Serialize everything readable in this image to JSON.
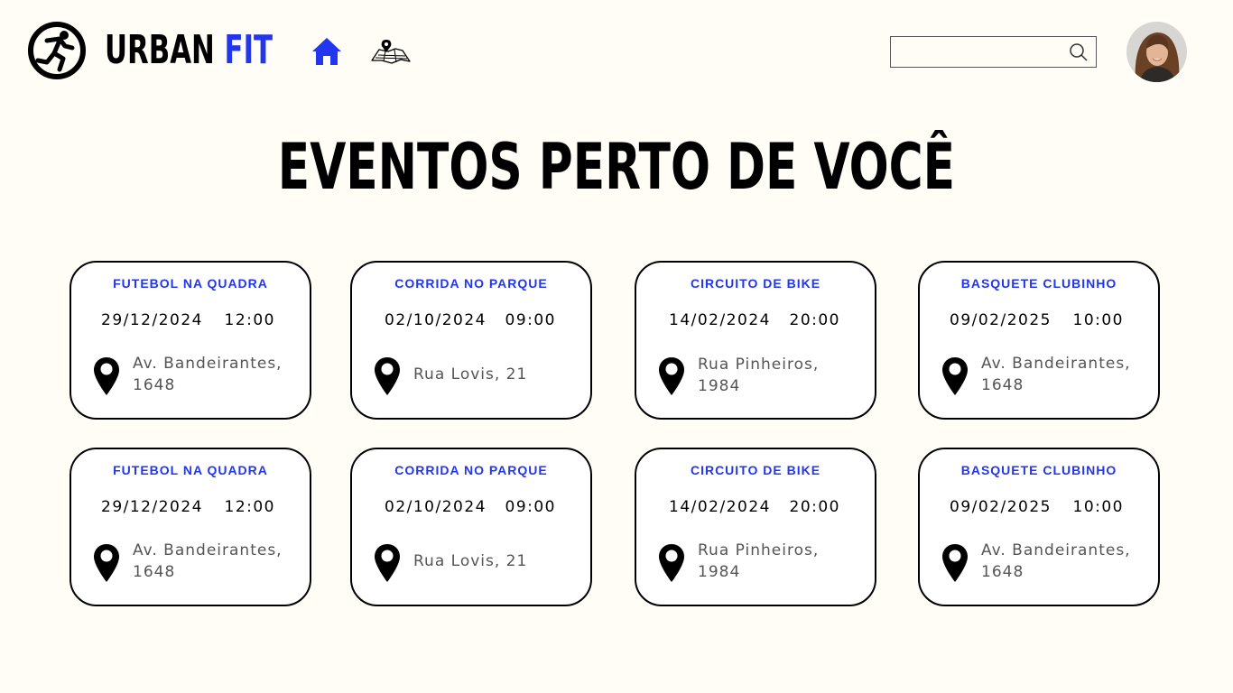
{
  "brand": {
    "name": "URBAN",
    "accent": "FIT"
  },
  "nav": {
    "home_icon": "home-icon",
    "map_icon": "map-icon"
  },
  "search": {
    "placeholder": "",
    "icon": "search-icon"
  },
  "page_title": "EVENTOS PERTO DE VOCÊ",
  "colors": {
    "accent": "#2236f0",
    "background": "#fffdf6"
  },
  "events": [
    {
      "title": "FUTEBOL NA QUADRA",
      "date": "29/12/2024",
      "time": "12:00",
      "address": "Av. Bandeirantes, 1648"
    },
    {
      "title": "CORRIDA NO PARQUE",
      "date": "02/10/2024",
      "time": "09:00",
      "address": "Rua Lovis, 21"
    },
    {
      "title": "CIRCUITO DE BIKE",
      "date": "14/02/2024",
      "time": "20:00",
      "address": "Rua Pinheiros, 1984"
    },
    {
      "title": "BASQUETE CLUBINHO",
      "date": "09/02/2025",
      "time": "10:00",
      "address": "Av. Bandeirantes, 1648"
    },
    {
      "title": "FUTEBOL NA QUADRA",
      "date": "29/12/2024",
      "time": "12:00",
      "address": "Av. Bandeirantes, 1648"
    },
    {
      "title": "CORRIDA NO PARQUE",
      "date": "02/10/2024",
      "time": "09:00",
      "address": "Rua Lovis, 21"
    },
    {
      "title": "CIRCUITO DE BIKE",
      "date": "14/02/2024",
      "time": "20:00",
      "address": "Rua Pinheiros, 1984"
    },
    {
      "title": "BASQUETE CLUBINHO",
      "date": "09/02/2025",
      "time": "10:00",
      "address": "Av. Bandeirantes, 1648"
    }
  ]
}
